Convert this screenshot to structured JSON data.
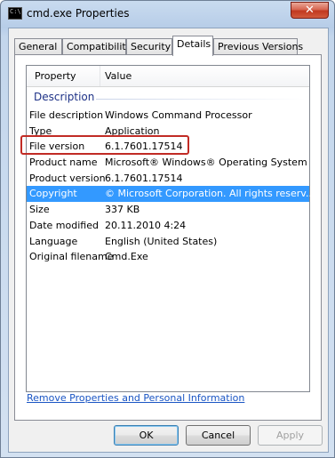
{
  "window": {
    "title": "cmd.exe Properties",
    "close_label": "✕"
  },
  "tabs": [
    {
      "label": "General"
    },
    {
      "label": "Compatibility"
    },
    {
      "label": "Security"
    },
    {
      "label": "Details"
    },
    {
      "label": "Previous Versions"
    }
  ],
  "list": {
    "columns": [
      "Property",
      "Value"
    ],
    "group": "Description",
    "rows": [
      {
        "property": "File description",
        "value": "Windows Command Processor"
      },
      {
        "property": "Type",
        "value": "Application"
      },
      {
        "property": "File version",
        "value": "6.1.7601.17514"
      },
      {
        "property": "Product name",
        "value": "Microsoft® Windows® Operating System"
      },
      {
        "property": "Product version",
        "value": "6.1.7601.17514"
      },
      {
        "property": "Copyright",
        "value": "© Microsoft Corporation. All rights reserv..."
      },
      {
        "property": "Size",
        "value": "337 KB"
      },
      {
        "property": "Date modified",
        "value": "20.11.2010 4:24"
      },
      {
        "property": "Language",
        "value": "English (United States)"
      },
      {
        "property": "Original filename",
        "value": "Cmd.Exe"
      }
    ]
  },
  "link": {
    "remove": "Remove Properties and Personal Information"
  },
  "buttons": {
    "ok": "OK",
    "cancel": "Cancel",
    "apply": "Apply"
  },
  "colors": {
    "selection": "#3399ff",
    "highlight_box": "#c12b25",
    "link": "#1a55c4"
  }
}
